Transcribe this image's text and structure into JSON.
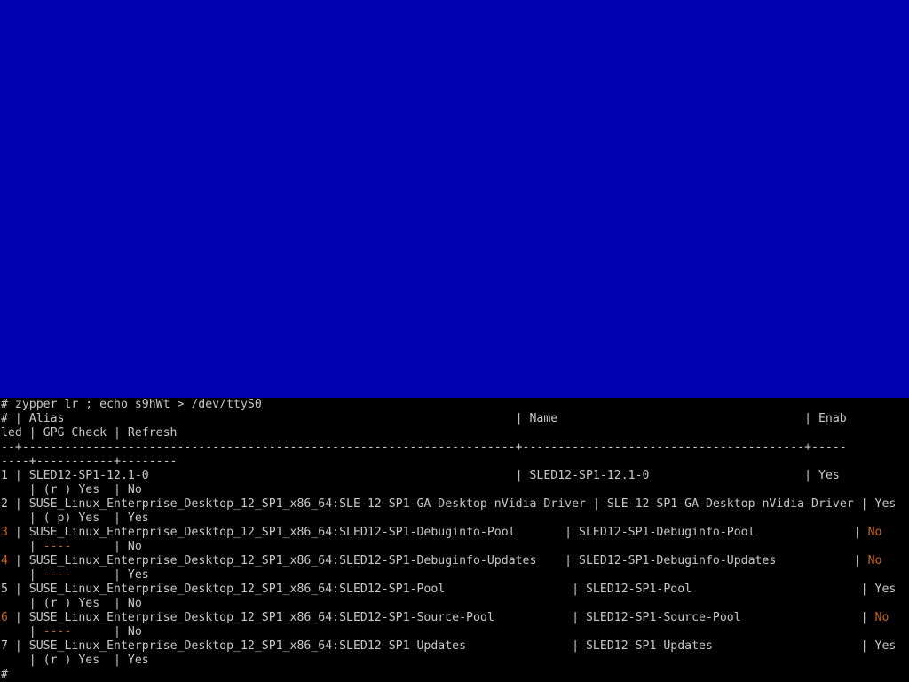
{
  "colors": {
    "console_background": "#0000b0",
    "terminal_background": "#000000",
    "terminal_text": "#c8c8c8",
    "disabled_highlight": "#c86418"
  },
  "terminal": {
    "command": "# zypper lr ; echo s9hWt > /dev/ttyS0",
    "header_1": "# | Alias                                                                | Name                                   | Enab",
    "header_2": "led | GPG Check | Refresh",
    "separator_1": "--+----------------------------------------------------------------------+----------------------------------------+-----",
    "separator_2": "----+-----------+--------",
    "repos": [
      {
        "num": "1",
        "row": " | SLED12-SP1-12.1-0                                                    | SLED12-SP1-12.1-0                      | ",
        "enabled": "Yes",
        "cont_pre": "    | ",
        "gpg": "(r ) Yes",
        "cont_post": "  | No"
      },
      {
        "num": "2",
        "row": " | SUSE_Linux_Enterprise_Desktop_12_SP1_x86_64:SLE-12-SP1-GA-Desktop-nVidia-Driver | SLE-12-SP1-GA-Desktop-nVidia-Driver | ",
        "enabled": "Yes",
        "cont_pre": "    | ",
        "gpg": "( p) Yes",
        "cont_post": "  | Yes"
      },
      {
        "num": "3",
        "row": " | SUSE_Linux_Enterprise_Desktop_12_SP1_x86_64:SLED12-SP1-Debuginfo-Pool       | SLED12-SP1-Debuginfo-Pool              | ",
        "enabled": "No",
        "cont_pre": "    | ",
        "gpg": "----",
        "cont_post": "      | No"
      },
      {
        "num": "4",
        "row": " | SUSE_Linux_Enterprise_Desktop_12_SP1_x86_64:SLED12-SP1-Debuginfo-Updates    | SLED12-SP1-Debuginfo-Updates           | ",
        "enabled": "No",
        "cont_pre": "    | ",
        "gpg": "----",
        "cont_post": "      | Yes"
      },
      {
        "num": "5",
        "row": " | SUSE_Linux_Enterprise_Desktop_12_SP1_x86_64:SLED12-SP1-Pool                  | SLED12-SP1-Pool                        | ",
        "enabled": "Yes",
        "cont_pre": "    | ",
        "gpg": "(r ) Yes",
        "cont_post": "  | No"
      },
      {
        "num": "6",
        "row": " | SUSE_Linux_Enterprise_Desktop_12_SP1_x86_64:SLED12-SP1-Source-Pool           | SLED12-SP1-Source-Pool                 | ",
        "enabled": "No",
        "cont_pre": "    | ",
        "gpg": "----",
        "cont_post": "      | No"
      },
      {
        "num": "7",
        "row": " | SUSE_Linux_Enterprise_Desktop_12_SP1_x86_64:SLED12-SP1-Updates               | SLED12-SP1-Updates                     | ",
        "enabled": "Yes",
        "cont_pre": "    | ",
        "gpg": "(r ) Yes",
        "cont_post": "  | Yes"
      }
    ],
    "prompt": "#"
  }
}
